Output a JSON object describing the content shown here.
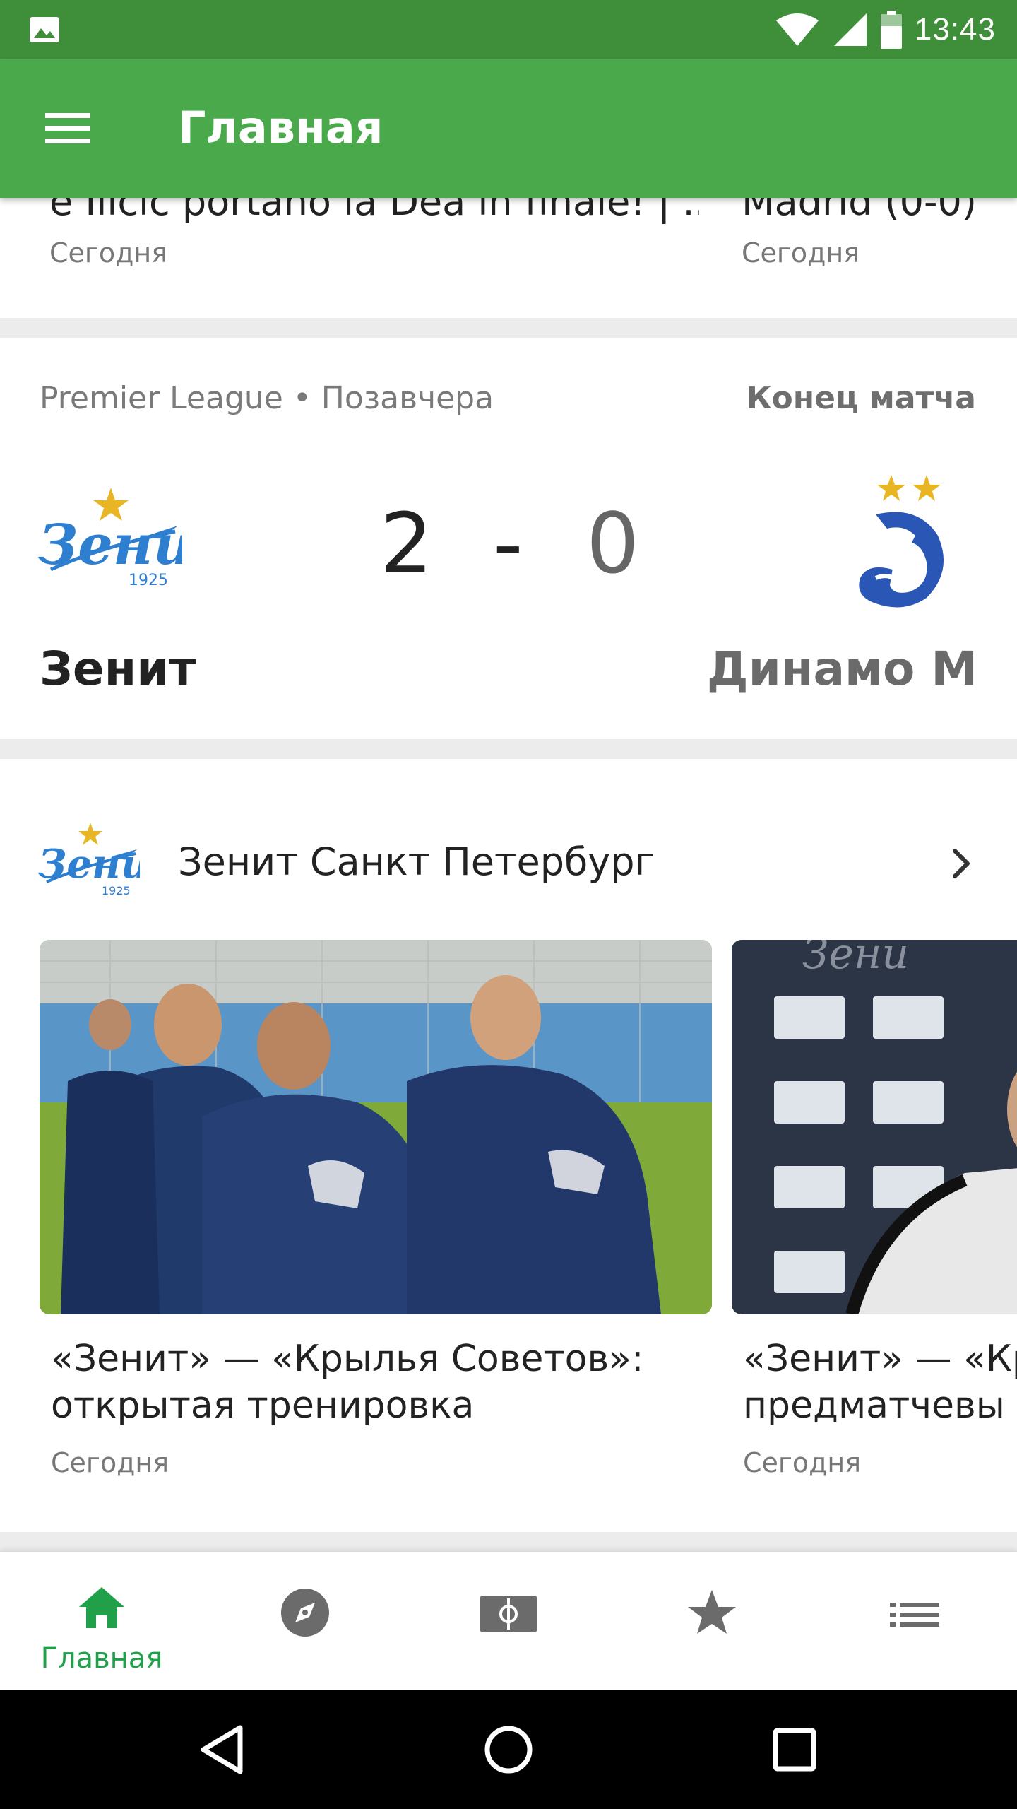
{
  "status_bar": {
    "time": "13:43",
    "icons": [
      "image-icon",
      "wifi-icon",
      "signal-icon",
      "battery-icon"
    ]
  },
  "app_bar": {
    "title": "Главная",
    "menu_icon": "hamburger-menu-icon"
  },
  "top_news": [
    {
      "title": "e Ilicic portano la Dea in finale! | ...",
      "date": "Сегодня"
    },
    {
      "title": "Madrid (0-0)",
      "date": "Сегодня"
    }
  ],
  "match": {
    "league": "Premier League • Позавчера",
    "status": "Конец матча",
    "home_team": "Зенит",
    "away_team": "Динамо М",
    "home_score": "2",
    "separator": "-",
    "away_score": "0"
  },
  "club_section": {
    "name": "Зенит Санкт Петербург",
    "articles": [
      {
        "title": "«Зенит» — «Крылья Советов»:\nоткрытая тренировка",
        "date": "Сегодня"
      },
      {
        "title": "«Зенит» — «Кр\nпредматчевы",
        "date": "Сегодня"
      }
    ]
  },
  "bottom_nav": {
    "items": [
      {
        "label": "Главная",
        "icon": "home-icon",
        "active": true
      },
      {
        "label": "",
        "icon": "compass-icon",
        "active": false
      },
      {
        "label": "",
        "icon": "football-pitch-icon",
        "active": false
      },
      {
        "label": "",
        "icon": "star-icon",
        "active": false
      },
      {
        "label": "",
        "icon": "list-icon",
        "active": false
      }
    ]
  },
  "colors": {
    "primary": "#4aa94a",
    "status_bar": "#3f8f3a",
    "accent": "#21a04a",
    "zenit_blue": "#2f7fd0",
    "dynamo_blue": "#2a57b5",
    "gold": "#e8b624"
  }
}
